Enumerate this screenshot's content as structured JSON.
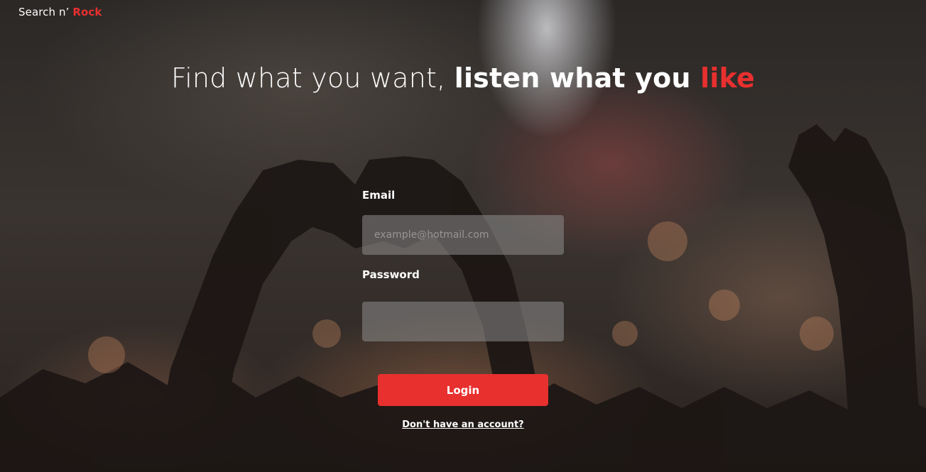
{
  "brand": {
    "name_plain": "Search n’ ",
    "name_accent": "Rock"
  },
  "headline": {
    "part_light": "Find what you want, ",
    "part_bold": "listen what you ",
    "part_accent": "like"
  },
  "form": {
    "email_label": "Email",
    "email_placeholder": "example@hotmail.com",
    "email_value": "",
    "password_label": "Password",
    "password_placeholder": "",
    "password_value": ""
  },
  "actions": {
    "login_label": "Login",
    "signup_link": "Don't have an account?"
  },
  "colors": {
    "accent": "#e8302f",
    "input_bg": "rgba(140,140,140,0.55)",
    "text": "#ffffff"
  }
}
